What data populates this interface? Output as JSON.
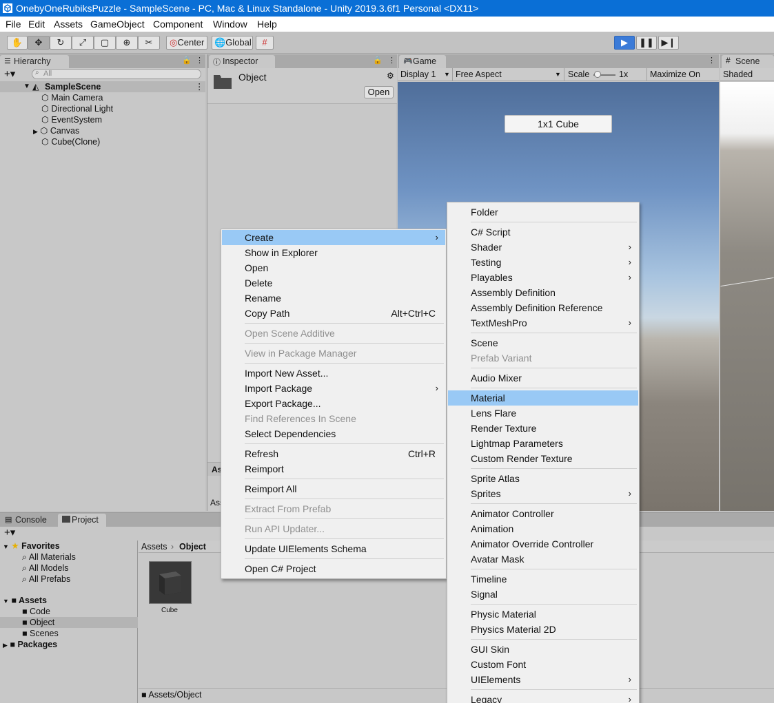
{
  "window": {
    "title": "OnebyOneRubiksPuzzle - SampleScene - PC, Mac & Linux Standalone - Unity 2019.3.6f1 Personal <DX11>"
  },
  "menubar": [
    "File",
    "Edit",
    "Assets",
    "GameObject",
    "Component",
    "Window",
    "Help"
  ],
  "toolbar": {
    "center": "Center",
    "global": "Global"
  },
  "hierarchy": {
    "tab": "Hierarchy",
    "search_placeholder": "All",
    "scene": "SampleScene",
    "items": [
      "Main Camera",
      "Directional Light",
      "EventSystem",
      "Canvas",
      "Cube(Clone)"
    ]
  },
  "inspector": {
    "tab": "Inspector",
    "object": "Object",
    "open_button": "Open",
    "clipped_1": "As",
    "clipped_2": "Ass"
  },
  "game": {
    "tab": "Game",
    "display": "Display 1",
    "aspect": "Free Aspect",
    "scale_label": "Scale",
    "scale_value": "1x",
    "maximize": "Maximize On Play",
    "button": "1x1 Cube"
  },
  "scene": {
    "tab": "Scene",
    "shading": "Shaded"
  },
  "bottom": {
    "tabs": [
      "Console",
      "Project"
    ],
    "favorites": {
      "label": "Favorites",
      "items": [
        "All Materials",
        "All Models",
        "All Prefabs"
      ]
    },
    "assets": {
      "label": "Assets",
      "items": [
        "Code",
        "Object",
        "Scenes"
      ]
    },
    "packages": "Packages",
    "breadcrumb": [
      "Assets",
      "Object"
    ],
    "asset_item": "Cube",
    "status_path": "Assets/Object"
  },
  "context_menu": {
    "items": [
      {
        "label": "Create",
        "submenu": true,
        "highlighted": true
      },
      {
        "label": "Show in Explorer"
      },
      {
        "label": "Open"
      },
      {
        "label": "Delete"
      },
      {
        "label": "Rename"
      },
      {
        "label": "Copy Path",
        "shortcut": "Alt+Ctrl+C"
      },
      {
        "sep": true
      },
      {
        "label": "Open Scene Additive",
        "disabled": true
      },
      {
        "sep": true
      },
      {
        "label": "View in Package Manager",
        "disabled": true
      },
      {
        "sep": true
      },
      {
        "label": "Import New Asset..."
      },
      {
        "label": "Import Package",
        "submenu": true
      },
      {
        "label": "Export Package..."
      },
      {
        "label": "Find References In Scene",
        "disabled": true
      },
      {
        "label": "Select Dependencies"
      },
      {
        "sep": true
      },
      {
        "label": "Refresh",
        "shortcut": "Ctrl+R"
      },
      {
        "label": "Reimport"
      },
      {
        "sep": true
      },
      {
        "label": "Reimport All"
      },
      {
        "sep": true
      },
      {
        "label": "Extract From Prefab",
        "disabled": true
      },
      {
        "sep": true
      },
      {
        "label": "Run API Updater...",
        "disabled": true
      },
      {
        "sep": true
      },
      {
        "label": "Update UIElements Schema"
      },
      {
        "sep": true
      },
      {
        "label": "Open C# Project"
      }
    ]
  },
  "create_menu": {
    "items": [
      {
        "label": "Folder"
      },
      {
        "sep": true
      },
      {
        "label": "C# Script"
      },
      {
        "label": "Shader",
        "submenu": true
      },
      {
        "label": "Testing",
        "submenu": true
      },
      {
        "label": "Playables",
        "submenu": true
      },
      {
        "label": "Assembly Definition"
      },
      {
        "label": "Assembly Definition Reference"
      },
      {
        "label": "TextMeshPro",
        "submenu": true
      },
      {
        "sep": true
      },
      {
        "label": "Scene"
      },
      {
        "label": "Prefab Variant",
        "disabled": true
      },
      {
        "sep": true
      },
      {
        "label": "Audio Mixer"
      },
      {
        "sep": true
      },
      {
        "label": "Material",
        "highlighted": true
      },
      {
        "label": "Lens Flare"
      },
      {
        "label": "Render Texture"
      },
      {
        "label": "Lightmap Parameters"
      },
      {
        "label": "Custom Render Texture"
      },
      {
        "sep": true
      },
      {
        "label": "Sprite Atlas"
      },
      {
        "label": "Sprites",
        "submenu": true
      },
      {
        "sep": true
      },
      {
        "label": "Animator Controller"
      },
      {
        "label": "Animation"
      },
      {
        "label": "Animator Override Controller"
      },
      {
        "label": "Avatar Mask"
      },
      {
        "sep": true
      },
      {
        "label": "Timeline"
      },
      {
        "label": "Signal"
      },
      {
        "sep": true
      },
      {
        "label": "Physic Material"
      },
      {
        "label": "Physics Material 2D"
      },
      {
        "sep": true
      },
      {
        "label": "GUI Skin"
      },
      {
        "label": "Custom Font"
      },
      {
        "label": "UIElements",
        "submenu": true
      },
      {
        "sep": true
      },
      {
        "label": "Legacy",
        "submenu": true
      }
    ]
  },
  "colors": {
    "titlebar": "#0a6fd6",
    "highlight": "#99c9f5",
    "play": "#3b7bd8"
  }
}
